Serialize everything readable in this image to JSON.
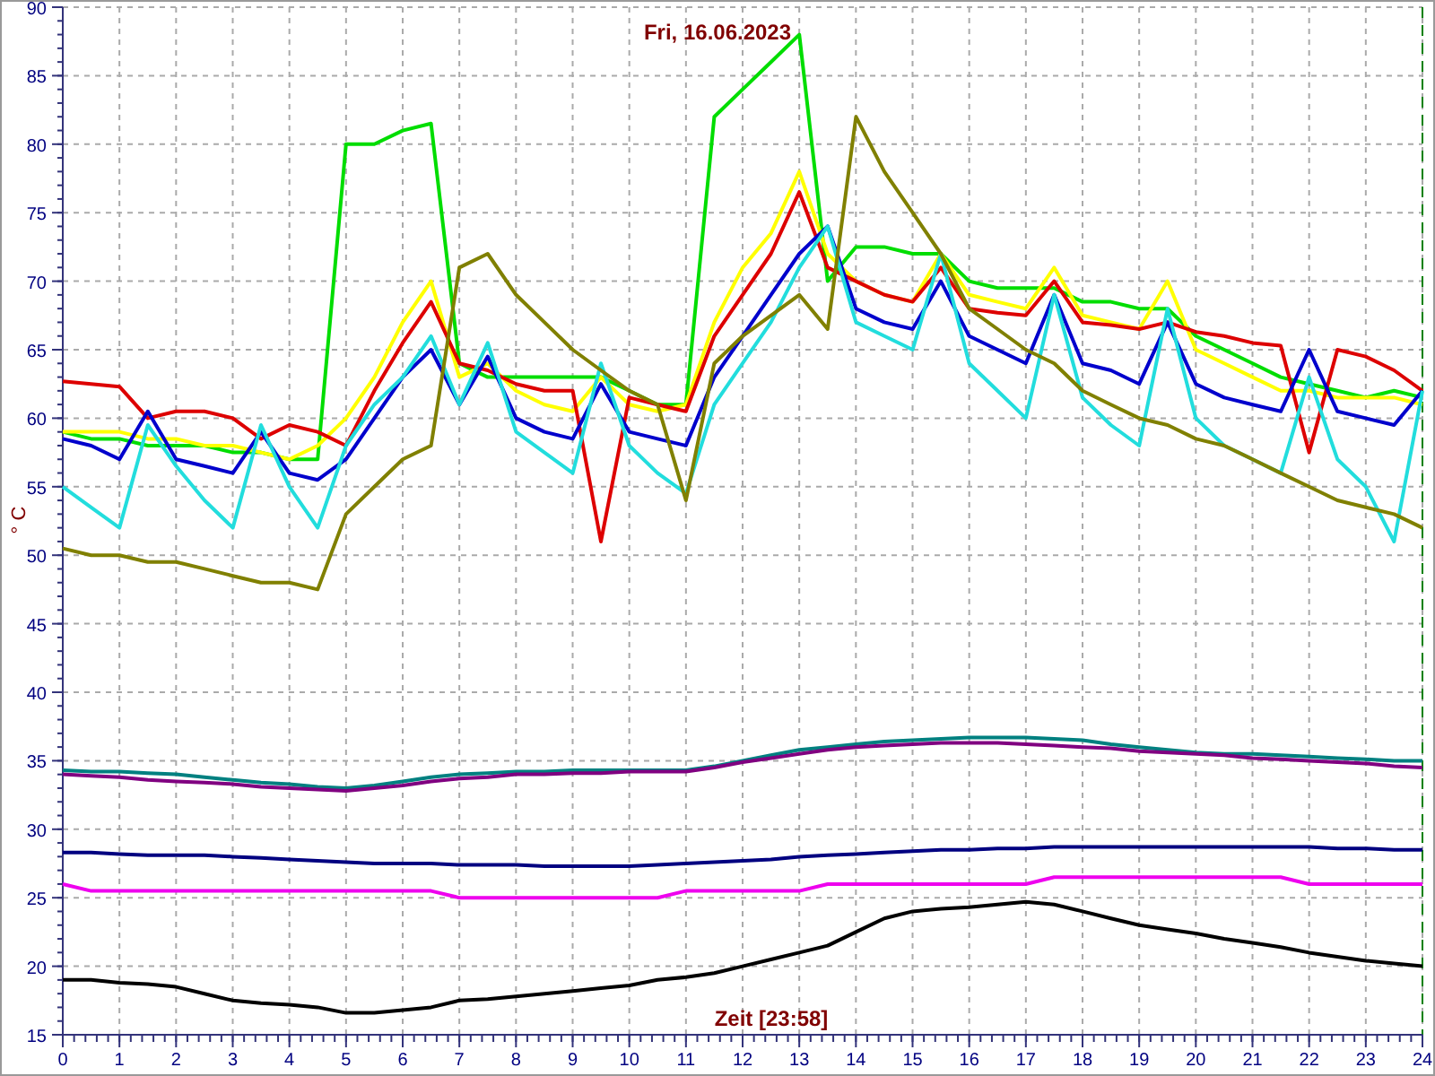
{
  "chart_data": {
    "type": "line",
    "title": "Fri, 16.06.2023",
    "xlabel": "Zeit [23:58]",
    "ylabel": "° C",
    "x": [
      0,
      0.5,
      1,
      1.5,
      2,
      2.5,
      3,
      3.5,
      4,
      4.5,
      5,
      5.5,
      6,
      6.5,
      7,
      7.5,
      8,
      8.5,
      9,
      9.5,
      10,
      10.5,
      11,
      11.5,
      12,
      12.5,
      13,
      13.5,
      14,
      14.5,
      15,
      15.5,
      16,
      16.5,
      17,
      17.5,
      18,
      18.5,
      19,
      19.5,
      20,
      20.5,
      21,
      21.5,
      22,
      22.5,
      23,
      23.5,
      24
    ],
    "xlim": [
      0,
      24
    ],
    "ylim": [
      15,
      90
    ],
    "grid": true,
    "xticks": [
      0,
      1,
      2,
      3,
      4,
      5,
      6,
      7,
      8,
      9,
      10,
      11,
      12,
      13,
      14,
      15,
      16,
      17,
      18,
      19,
      20,
      21,
      22,
      23,
      24
    ],
    "yticks": [
      15,
      20,
      25,
      30,
      35,
      40,
      45,
      50,
      55,
      60,
      65,
      70,
      75,
      80,
      85,
      90
    ],
    "series": [
      {
        "color": "#00dd00",
        "values": [
          59,
          58.5,
          58.5,
          58,
          58,
          58,
          57.5,
          57.5,
          57,
          57,
          80,
          80,
          81,
          81.5,
          64,
          63,
          63,
          63,
          63,
          63,
          62,
          61,
          61,
          82,
          84,
          86,
          88,
          70,
          72.5,
          72.5,
          72,
          72,
          70,
          69.5,
          69.5,
          69.5,
          68.5,
          68.5,
          68,
          68,
          66,
          65,
          64,
          63,
          62.5,
          62,
          61.5,
          62,
          61.5
        ]
      },
      {
        "color": "#ffff00",
        "values": [
          59,
          59,
          59,
          58.5,
          58.5,
          58,
          58,
          57.5,
          57,
          58,
          60,
          63,
          67,
          70,
          63,
          64,
          62,
          61,
          60.5,
          63,
          61,
          60.5,
          61,
          67,
          71,
          73.5,
          78,
          72,
          70,
          69,
          68.5,
          72,
          69,
          68.5,
          68,
          71,
          67.5,
          67,
          66.5,
          70,
          65,
          64,
          63,
          62,
          62,
          61.5,
          61.5,
          61.5,
          61
        ]
      },
      {
        "color": "#dd0000",
        "values": [
          62.7,
          62.5,
          62.3,
          60,
          60.5,
          60.5,
          60,
          58.5,
          59.5,
          59,
          58,
          62,
          65.5,
          68.5,
          64,
          63.5,
          62.5,
          62,
          62,
          51,
          61.5,
          61,
          60.5,
          66,
          69,
          72,
          76.5,
          71,
          70,
          69,
          68.5,
          71,
          68,
          67.7,
          67.5,
          70,
          67,
          66.8,
          66.5,
          67,
          66.3,
          66,
          65.5,
          65.3,
          57.5,
          65,
          64.5,
          63.5,
          62
        ]
      },
      {
        "color": "#0000cc",
        "values": [
          58.5,
          58,
          57,
          60.5,
          57,
          56.5,
          56,
          59,
          56,
          55.5,
          57,
          60,
          63,
          65,
          61,
          64.5,
          60,
          59,
          58.5,
          62.5,
          59,
          58.5,
          58,
          63,
          66,
          69,
          72,
          74,
          68,
          67,
          66.5,
          70,
          66,
          65,
          64,
          69,
          64,
          63.5,
          62.5,
          67,
          62.5,
          61.5,
          61,
          60.5,
          65,
          60.5,
          60,
          59.5,
          62
        ]
      },
      {
        "color": "#22dddd",
        "values": [
          55,
          53.5,
          52,
          59.5,
          56.5,
          54,
          52,
          59.5,
          55,
          52,
          58,
          61,
          63,
          66,
          61,
          65.5,
          59,
          57.5,
          56,
          64,
          58,
          56,
          54.5,
          61,
          64,
          67,
          71,
          74,
          67,
          66,
          65,
          72,
          64,
          62,
          60,
          69,
          61.5,
          59.5,
          58,
          68,
          60,
          58,
          57,
          56,
          63,
          57,
          55,
          51,
          62
        ]
      },
      {
        "color": "#808000",
        "values": [
          50.5,
          50,
          50,
          49.5,
          49.5,
          49,
          48.5,
          48,
          48,
          47.5,
          53,
          55,
          57,
          58,
          71,
          72,
          69,
          67,
          65,
          63.5,
          62,
          61,
          54,
          64,
          66,
          67.5,
          69,
          66.5,
          82,
          78,
          75,
          72,
          68,
          66.5,
          65,
          64,
          62,
          61,
          60,
          59.5,
          58.5,
          58,
          57,
          56,
          55,
          54,
          53.5,
          53,
          52
        ]
      },
      {
        "color": "#008080",
        "values": [
          34.3,
          34.2,
          34.2,
          34.1,
          34,
          33.8,
          33.6,
          33.4,
          33.3,
          33.1,
          33,
          33.2,
          33.5,
          33.8,
          34,
          34.1,
          34.2,
          34.2,
          34.3,
          34.3,
          34.3,
          34.3,
          34.3,
          34.6,
          35,
          35.4,
          35.8,
          36,
          36.2,
          36.4,
          36.5,
          36.6,
          36.7,
          36.7,
          36.7,
          36.6,
          36.5,
          36.2,
          36,
          35.8,
          35.6,
          35.5,
          35.5,
          35.4,
          35.3,
          35.2,
          35.1,
          35,
          35
        ]
      },
      {
        "color": "#800080",
        "values": [
          34,
          33.9,
          33.8,
          33.6,
          33.5,
          33.4,
          33.3,
          33.1,
          33,
          32.9,
          32.8,
          33,
          33.2,
          33.5,
          33.7,
          33.8,
          34,
          34,
          34.1,
          34.1,
          34.2,
          34.2,
          34.2,
          34.5,
          34.9,
          35.2,
          35.5,
          35.8,
          36,
          36.1,
          36.2,
          36.3,
          36.3,
          36.3,
          36.2,
          36.1,
          36,
          35.9,
          35.7,
          35.6,
          35.5,
          35.4,
          35.2,
          35.1,
          35,
          34.9,
          34.8,
          34.6,
          34.5
        ]
      },
      {
        "color": "#000080",
        "values": [
          28.3,
          28.3,
          28.2,
          28.1,
          28.1,
          28.1,
          28,
          27.9,
          27.8,
          27.7,
          27.6,
          27.5,
          27.5,
          27.5,
          27.4,
          27.4,
          27.4,
          27.3,
          27.3,
          27.3,
          27.3,
          27.4,
          27.5,
          27.6,
          27.7,
          27.8,
          28,
          28.1,
          28.2,
          28.3,
          28.4,
          28.5,
          28.5,
          28.6,
          28.6,
          28.7,
          28.7,
          28.7,
          28.7,
          28.7,
          28.7,
          28.7,
          28.7,
          28.7,
          28.7,
          28.6,
          28.6,
          28.5,
          28.5
        ]
      },
      {
        "color": "#ee00ee",
        "values": [
          26,
          25.5,
          25.5,
          25.5,
          25.5,
          25.5,
          25.5,
          25.5,
          25.5,
          25.5,
          25.5,
          25.5,
          25.5,
          25.5,
          25,
          25,
          25,
          25,
          25,
          25,
          25,
          25,
          25.5,
          25.5,
          25.5,
          25.5,
          25.5,
          26,
          26,
          26,
          26,
          26,
          26,
          26,
          26,
          26.5,
          26.5,
          26.5,
          26.5,
          26.5,
          26.5,
          26.5,
          26.5,
          26.5,
          26,
          26,
          26,
          26,
          26
        ]
      },
      {
        "color": "#000000",
        "values": [
          19,
          19,
          18.8,
          18.7,
          18.5,
          18,
          17.5,
          17.3,
          17.2,
          17,
          16.6,
          16.6,
          16.8,
          17,
          17.5,
          17.6,
          17.8,
          18,
          18.2,
          18.4,
          18.6,
          19,
          19.2,
          19.5,
          20,
          20.5,
          21,
          21.5,
          22.5,
          23.5,
          24,
          24.2,
          24.3,
          24.5,
          24.7,
          24.5,
          24,
          23.5,
          23,
          22.7,
          22.4,
          22,
          21.7,
          21.4,
          21,
          20.7,
          20.4,
          20.2,
          20
        ]
      }
    ]
  }
}
